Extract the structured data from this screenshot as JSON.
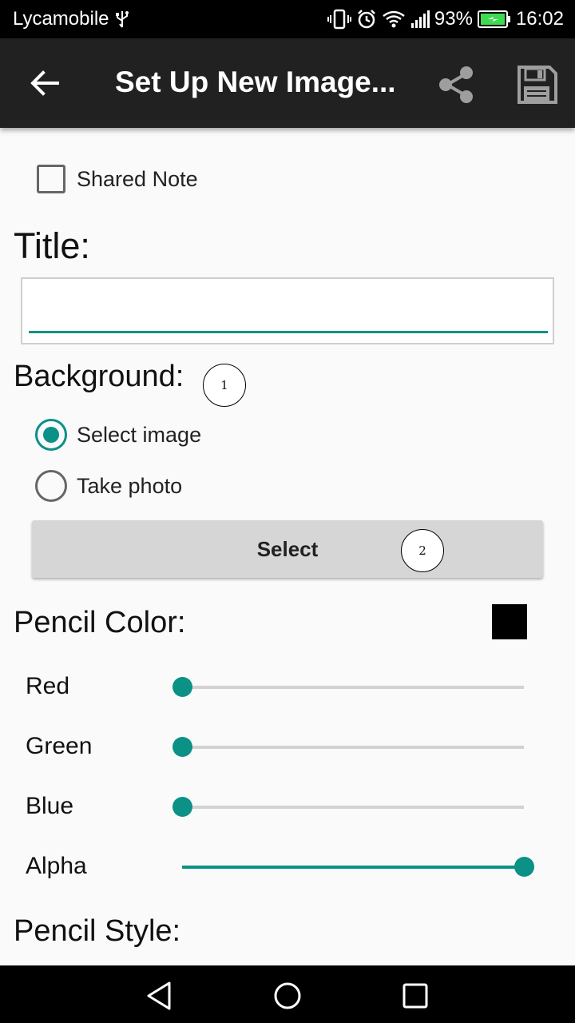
{
  "status_bar": {
    "carrier": "Lycamobile",
    "battery": "93%",
    "time": "16:02",
    "icons": [
      "usb-icon",
      "vibrate-icon",
      "alarm-icon",
      "wifi-icon",
      "signal-icon",
      "battery-charging-icon"
    ]
  },
  "toolbar": {
    "title": "Set Up New Image...",
    "icons": [
      "back-arrow-icon",
      "share-icon",
      "save-icon"
    ]
  },
  "shared_note": {
    "label": "Shared Note",
    "checked": false
  },
  "title_section": {
    "heading": "Title:",
    "value": "",
    "placeholder": ""
  },
  "background": {
    "heading": "Background:",
    "options": [
      {
        "label": "Select image",
        "selected": true
      },
      {
        "label": "Take photo",
        "selected": false
      }
    ],
    "button_label": "Select"
  },
  "markers": [
    "1",
    "2"
  ],
  "pencil_color": {
    "heading": "Pencil Color:",
    "swatch_color": "#000000",
    "sliders": [
      {
        "label": "Red",
        "value": 0.0
      },
      {
        "label": "Green",
        "value": 0.0
      },
      {
        "label": "Blue",
        "value": 0.0
      },
      {
        "label": "Alpha",
        "value": 1.0
      }
    ]
  },
  "pencil_style": {
    "heading": "Pencil Style:"
  },
  "colors": {
    "accent": "#0b9186",
    "toolbar": "#212121"
  },
  "nav_bar": {
    "icons": [
      "nav-back-icon",
      "nav-home-icon",
      "nav-recents-icon"
    ]
  }
}
